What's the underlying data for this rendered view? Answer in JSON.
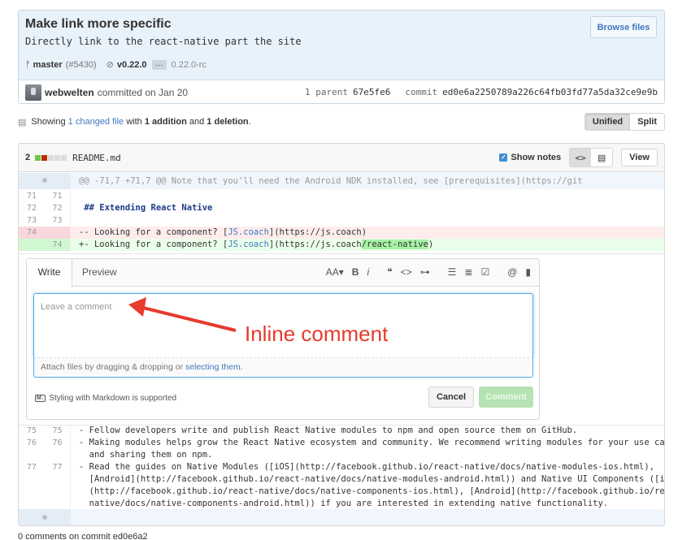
{
  "commit": {
    "title": "Make link more specific",
    "description": "Directly link to the react-native part the site",
    "browse_label": "Browse files",
    "branch": "master",
    "pr": "(#5430)",
    "tag": "v0.22.0",
    "ellipsis": "…",
    "tag_rc": "0.22.0-rc",
    "author": "webwelten",
    "committed_text": "committed on Jan 20",
    "parent_label": "1 parent",
    "parent_sha": "67e5fe6",
    "commit_label": "commit",
    "commit_sha": "ed0e6a2250789a226c64fb03fd77a5da32ce9e9b"
  },
  "summary": {
    "showing": "Showing",
    "changed": "1 changed file",
    "with": "with",
    "additions": "1 addition",
    "and": "and",
    "deletions": "1 deletion",
    "period": ".",
    "unified": "Unified",
    "split": "Split"
  },
  "file": {
    "count": "2",
    "name": "README.md",
    "show_notes": "Show notes",
    "code_icon": "<>",
    "view": "View",
    "hunk": "@@ -71,7 +71,7 @@ Note that you'll need the Android NDK installed, see [prerequisites](https://git",
    "lines": [
      {
        "old": "71",
        "new": "71",
        "text": ""
      },
      {
        "old": "72",
        "new": "72",
        "text": " ## Extending React Native"
      },
      {
        "old": "73",
        "new": "73",
        "text": ""
      }
    ],
    "del": {
      "old": "74",
      "prefix": "-- Looking for a component? [",
      "link": "JS.coach",
      "suffix": "](https://js.coach)"
    },
    "add": {
      "new": "74",
      "prefix": "+- Looking for a component? [",
      "link": "JS.coach",
      "mid": "](https://js.coach",
      "hl": "/react-native",
      "suffix": ")"
    },
    "bottom": [
      {
        "old": "75",
        "new": "75",
        "text": "- Fellow developers write and publish React Native modules to npm and open source them on GitHub."
      },
      {
        "old": "76",
        "new": "76",
        "text": "- Making modules helps grow the React Native ecosystem and community. We recommend writing modules for your use cases"
      },
      {
        "old": "",
        "new": "",
        "text": "  and sharing them on npm."
      },
      {
        "old": "77",
        "new": "77",
        "text": "- Read the guides on Native Modules ([iOS](http://facebook.github.io/react-native/docs/native-modules-ios.html),"
      },
      {
        "old": "",
        "new": "",
        "text": "  [Android](http://facebook.github.io/react-native/docs/native-modules-android.html)) and Native UI Components ([iOS]"
      },
      {
        "old": "",
        "new": "",
        "text": "  (http://facebook.github.io/react-native/docs/native-components-ios.html), [Android](http://facebook.github.io/react-"
      },
      {
        "old": "",
        "new": "",
        "text": "  native/docs/native-components-android.html)) if you are interested in extending native functionality."
      }
    ]
  },
  "comment": {
    "tab_write": "Write",
    "tab_preview": "Preview",
    "placeholder": "Leave a comment",
    "attach_prefix": "Attach files by dragging & dropping or",
    "attach_link": "selecting them.",
    "md_note": "Styling with Markdown is supported",
    "cancel": "Cancel",
    "submit": "Comment"
  },
  "annotation": {
    "text": "Inline comment",
    "color": "#e63b2e"
  },
  "footer_text": "0 comments on commit ed0e6a2"
}
